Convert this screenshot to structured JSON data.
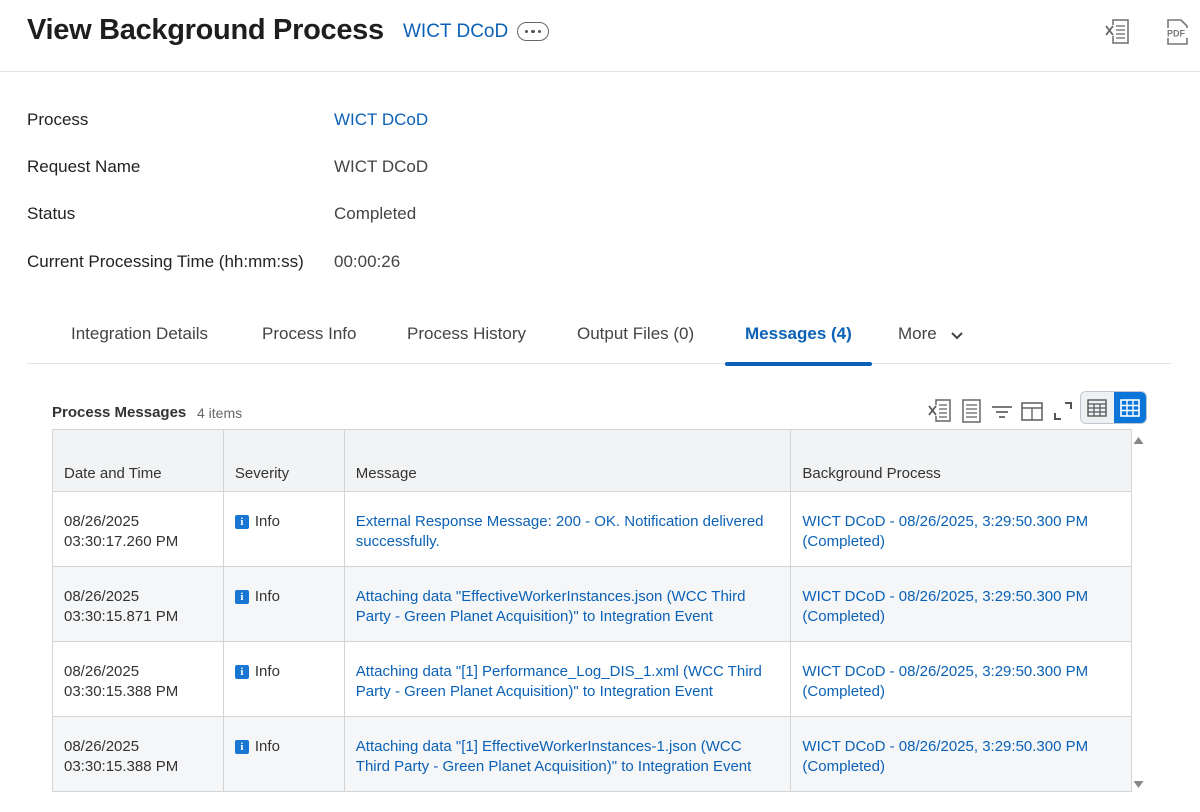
{
  "header": {
    "title": "View Background Process",
    "link": "WICT DCoD",
    "excel_icon": "excel-export-icon",
    "pdf_icon": "pdf-export-icon"
  },
  "fields": [
    {
      "label": "Process",
      "value": "WICT DCoD",
      "is_link": true
    },
    {
      "label": "Request Name",
      "value": "WICT DCoD",
      "is_link": false
    },
    {
      "label": "Status",
      "value": "Completed",
      "is_link": false
    },
    {
      "label": "Current Processing Time (hh:mm:ss)",
      "value": "00:00:26",
      "is_link": false
    }
  ],
  "tabs": [
    {
      "label": "Integration Details"
    },
    {
      "label": "Process Info"
    },
    {
      "label": "Process History"
    },
    {
      "label": "Output Files (0)"
    },
    {
      "label": "Messages (4)",
      "active": true
    },
    {
      "label": "More"
    }
  ],
  "grid": {
    "title": "Process Messages",
    "count": "4 items",
    "columns": [
      "Date and Time",
      "Severity",
      "Message",
      "Background Process"
    ],
    "rows": [
      {
        "date": "08/26/2025",
        "time": "03:30:17.260 PM",
        "severity": "Info",
        "message": "External Response Message: 200 - OK. Notification delivered successfully.",
        "process": "WICT DCoD - 08/26/2025, 3:29:50.300 PM (Completed)"
      },
      {
        "date": "08/26/2025",
        "time": "03:30:15.871 PM",
        "severity": "Info",
        "message": "Attaching data \"EffectiveWorkerInstances.json (WCC Third Party - Green Planet Acquisition)\" to Integration Event",
        "process": "WICT DCoD - 08/26/2025, 3:29:50.300 PM (Completed)"
      },
      {
        "date": "08/26/2025",
        "time": "03:30:15.388 PM",
        "severity": "Info",
        "message": "Attaching data \"[1] Performance_Log_DIS_1.xml (WCC Third Party - Green Planet Acquisition)\" to Integration Event",
        "process": "WICT DCoD - 08/26/2025, 3:29:50.300 PM (Completed)"
      },
      {
        "date": "08/26/2025",
        "time": "03:30:15.388 PM",
        "severity": "Info",
        "message": "Attaching data \"[1] EffectiveWorkerInstances-1.json (WCC Third Party - Green Planet Acquisition)\" to Integration Event",
        "process": "WICT DCoD - 08/26/2025, 3:29:50.300 PM (Completed)"
      }
    ]
  },
  "colors": {
    "link": "#0b61b6",
    "active_tab": "#0b61b6",
    "toggle_on": "#0b75d9",
    "info_icon": "#1976d2"
  }
}
